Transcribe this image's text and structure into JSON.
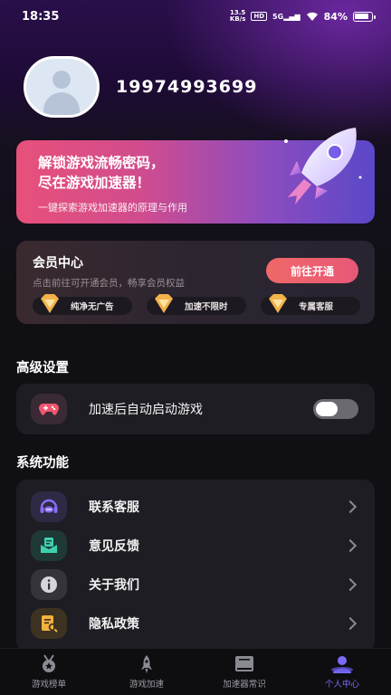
{
  "status_bar": {
    "time": "18:35",
    "net_speed_value": "13.5",
    "net_speed_unit": "KB/s",
    "hd": "HD",
    "network": "5G",
    "battery": "84%"
  },
  "profile": {
    "phone": "19974993699"
  },
  "promo": {
    "title_line1": "解锁游戏流畅密码，",
    "title_line2": "尽在游戏加速器！",
    "subtitle": "一键探索游戏加速器的原理与作用"
  },
  "vip": {
    "title": "会员中心",
    "subtitle": "点击前往可开通会员，畅享会员权益",
    "button": "前往开通",
    "perks": [
      "纯净无广告",
      "加速不限时",
      "专属客服"
    ]
  },
  "advanced": {
    "title": "高级设置",
    "auto_launch_label": "加速后自动启动游戏",
    "auto_launch_enabled": false
  },
  "system": {
    "title": "系统功能",
    "items": [
      {
        "label": "联系客服",
        "icon": "headset-icon"
      },
      {
        "label": "意见反馈",
        "icon": "feedback-icon"
      },
      {
        "label": "关于我们",
        "icon": "info-icon"
      },
      {
        "label": "隐私政策",
        "icon": "privacy-document-icon"
      }
    ]
  },
  "tabbar": {
    "tabs": [
      {
        "label": "游戏榜单",
        "icon": "medal-icon",
        "active": false
      },
      {
        "label": "游戏加速",
        "icon": "rocket-icon",
        "active": false
      },
      {
        "label": "加速器常识",
        "icon": "book-icon",
        "active": false
      },
      {
        "label": "个人中心",
        "icon": "user-icon",
        "active": true
      }
    ]
  },
  "colors": {
    "accent": "#7a6cf8",
    "vip_button": "#ee6070",
    "background": "#101014",
    "card": "#1e1d23"
  }
}
